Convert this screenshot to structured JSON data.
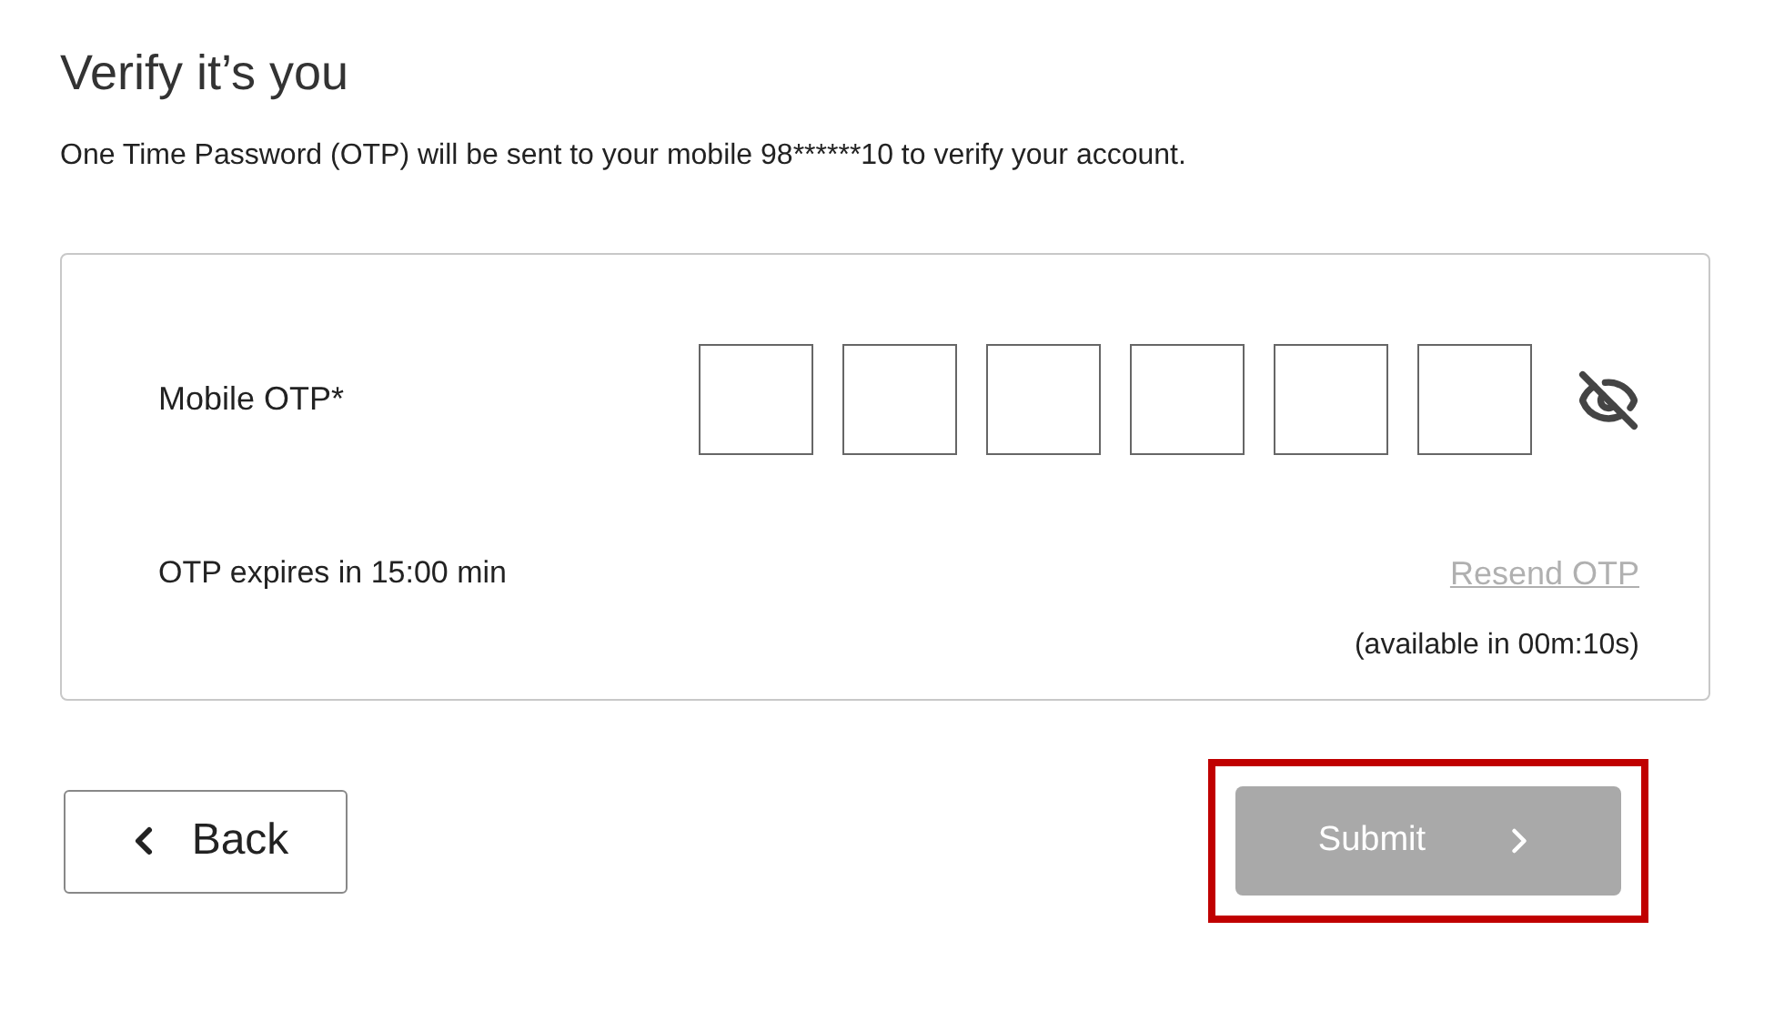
{
  "title": "Verify it’s you",
  "description": "One Time Password (OTP) will be sent to your mobile 98******10 to verify your account.",
  "otp": {
    "label": "Mobile OTP*",
    "digit_fields": [
      {
        "filled": false
      },
      {
        "filled": false
      },
      {
        "filled": false
      },
      {
        "filled": false
      },
      {
        "filled": false
      },
      {
        "filled": false
      }
    ],
    "masked": true,
    "expiry": "OTP expires in 15:00 min",
    "resend": {
      "label": "Resend OTP",
      "disabled": true
    },
    "availability": "(available in 00m:10s)"
  },
  "back_button": {
    "label": "Back"
  },
  "submit_button": {
    "label": "Submit",
    "disabled": true,
    "highlighted": true
  }
}
